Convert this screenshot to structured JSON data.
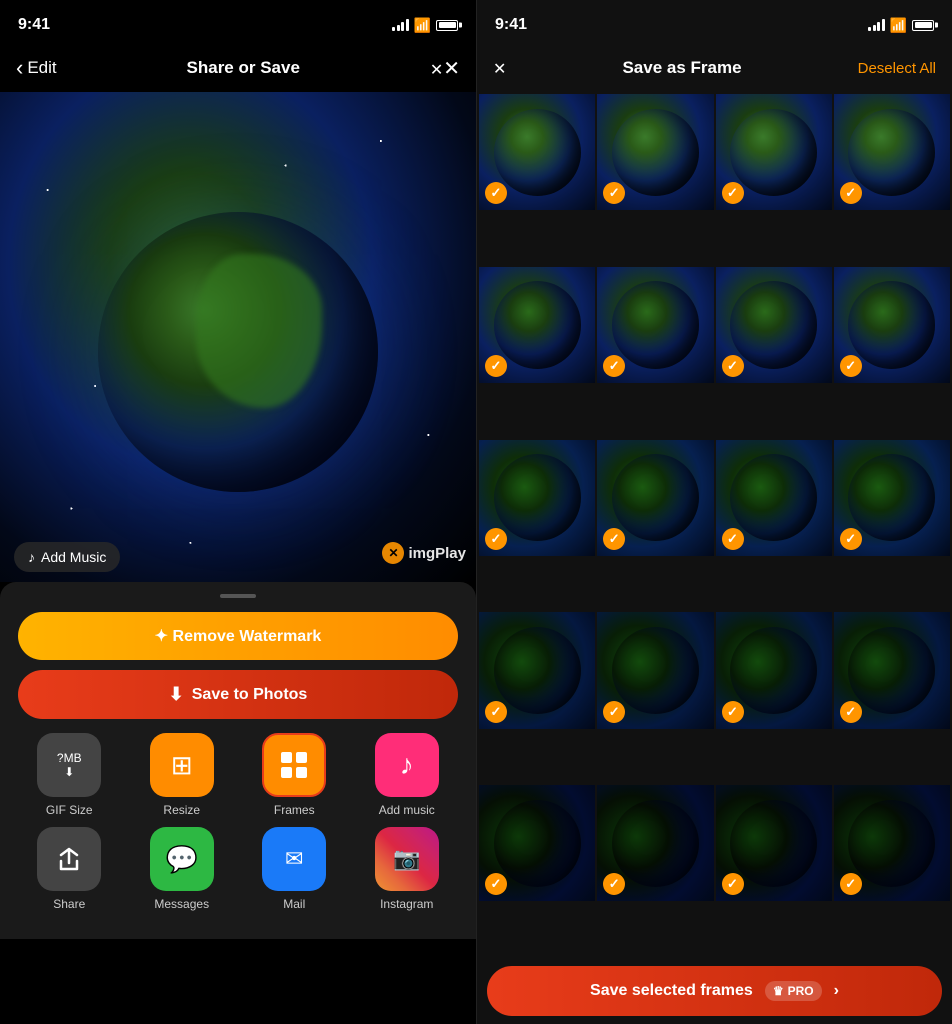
{
  "left": {
    "status": {
      "time": "9:41",
      "signal": "signal",
      "wifi": "wifi",
      "battery": "battery"
    },
    "nav": {
      "back_label": "Edit",
      "title": "Share or Save",
      "close_label": "✕"
    },
    "music_btn": "Add Music",
    "watermark_text": "imgPlay",
    "remove_watermark_btn": "✦ Remove Watermark",
    "save_photos_btn": "Save to Photos",
    "actions_row1": [
      {
        "id": "gif-size",
        "icon": "?MB↓",
        "label": "GIF Size",
        "style": "gif"
      },
      {
        "id": "resize",
        "icon": "⊞↔",
        "label": "Resize",
        "style": "resize"
      },
      {
        "id": "frames",
        "icon": "⊞",
        "label": "Frames",
        "style": "frames",
        "selected": true
      },
      {
        "id": "add-music",
        "icon": "♪",
        "label": "Add music",
        "style": "music"
      }
    ],
    "actions_row2": [
      {
        "id": "share",
        "icon": "↑",
        "label": "Share",
        "style": "share"
      },
      {
        "id": "messages",
        "icon": "💬",
        "label": "Messages",
        "style": "messages"
      },
      {
        "id": "mail",
        "icon": "✉",
        "label": "Mail",
        "style": "mail"
      },
      {
        "id": "instagram",
        "icon": "◎",
        "label": "Instagram",
        "style": "instagram"
      }
    ]
  },
  "right": {
    "status": {
      "time": "9:41"
    },
    "nav": {
      "close_label": "✕",
      "title": "Save as Frame",
      "deselect_label": "Deselect All"
    },
    "frames_count": 20,
    "save_btn": "Save selected frames",
    "pro_label": "PRO"
  }
}
